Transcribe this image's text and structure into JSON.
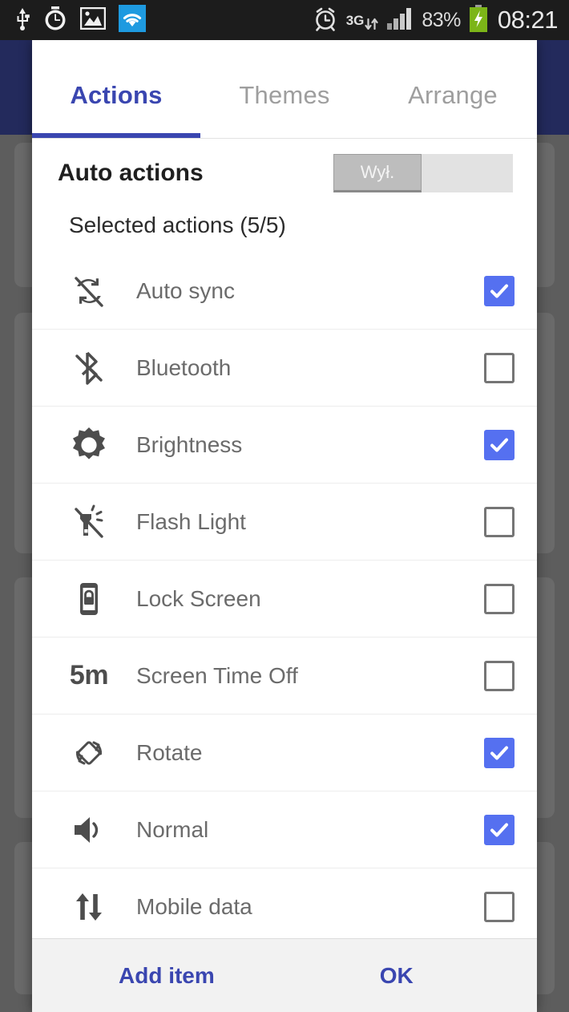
{
  "status_bar": {
    "left_icons": [
      {
        "name": "usb-icon",
        "glyph": "usb"
      },
      {
        "name": "alarm-timer-icon",
        "glyph": "timer"
      },
      {
        "name": "gallery-image-icon",
        "glyph": "image"
      },
      {
        "name": "wifi-icon",
        "glyph": "wifi",
        "highlight_color": "#1e9ae0"
      }
    ],
    "alarm_icon_name": "alarm-clock-icon",
    "network_type": "3G",
    "network_arrows": "↓↑",
    "signal_icon_name": "signal-bars-icon",
    "battery_percent": "83%",
    "battery_icon_name": "battery-charging-icon",
    "battery_color": "#7cb518",
    "clock": "08:21"
  },
  "dialog": {
    "tabs": [
      {
        "label": "Actions",
        "active": true
      },
      {
        "label": "Themes",
        "active": false
      },
      {
        "label": "Arrange",
        "active": false
      }
    ],
    "active_tab_color": "#3a46b0",
    "auto_actions": {
      "label": "Auto actions",
      "toggle_value": "Wył."
    },
    "selected_actions_caption": "Selected actions (5/5)",
    "checkbox_checked_color": "#5570f0",
    "actions": [
      {
        "icon": "auto-sync-off-icon",
        "label": "Auto sync",
        "checked": true
      },
      {
        "icon": "bluetooth-off-icon",
        "label": "Bluetooth",
        "checked": false
      },
      {
        "icon": "brightness-icon",
        "label": "Brightness",
        "checked": true
      },
      {
        "icon": "flashlight-off-icon",
        "label": "Flash Light",
        "checked": false
      },
      {
        "icon": "lock-screen-icon",
        "label": "Lock Screen",
        "checked": false
      },
      {
        "icon": "screen-timeout-icon",
        "label": "Screen Time Off",
        "checked": false,
        "icon_text": "5m"
      },
      {
        "icon": "rotate-icon",
        "label": "Rotate",
        "checked": true
      },
      {
        "icon": "volume-normal-icon",
        "label": "Normal",
        "checked": true
      },
      {
        "icon": "mobile-data-icon",
        "label": "Mobile data",
        "checked": false
      }
    ],
    "footer": {
      "add_item_label": "Add item",
      "ok_label": "OK"
    }
  }
}
